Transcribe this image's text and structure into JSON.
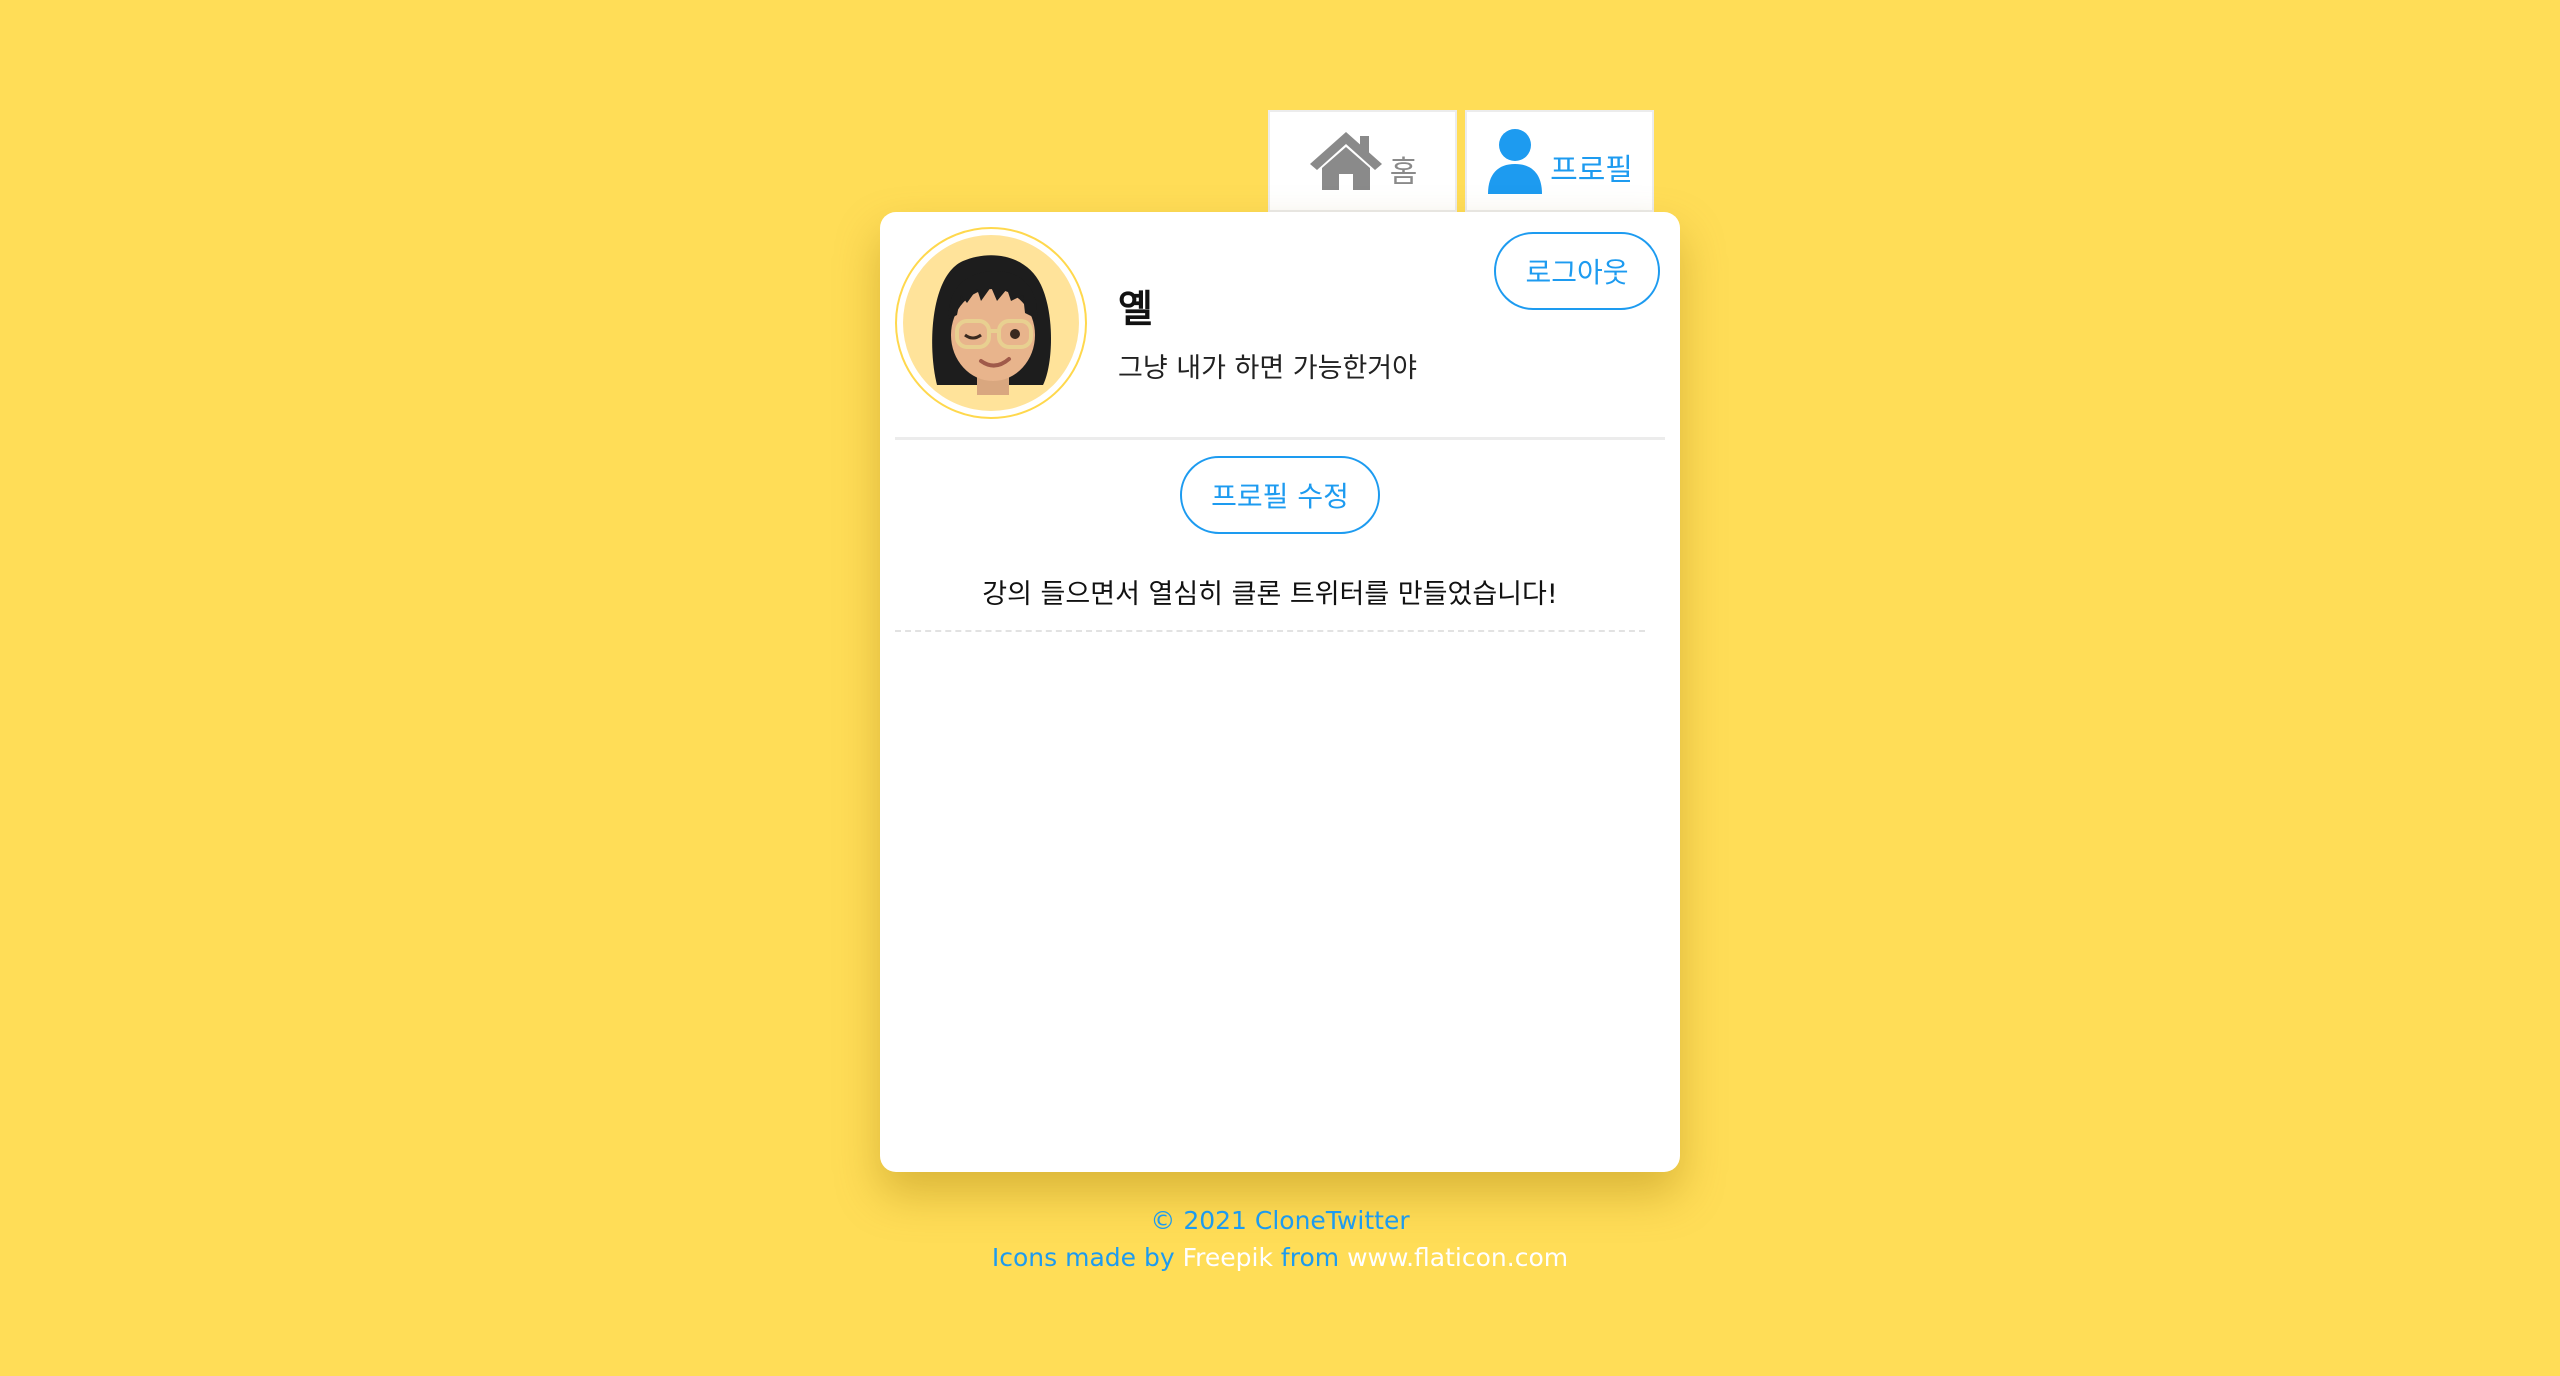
{
  "nav": {
    "home_label": "홈",
    "profile_label": "프로필"
  },
  "profile": {
    "name": "옐",
    "bio": "그냥 내가 하면 가능한거야",
    "logout_label": "로그아웃",
    "edit_label": "프로필 수정"
  },
  "tweets": [
    {
      "text": "강의 들으면서 열심히 클론 트위터를 만들었습니다!"
    }
  ],
  "footer": {
    "copyright": "© 2021 CloneTwitter",
    "icons_prefix": "Icons made by",
    "author": "Freepik",
    "from": "from",
    "site": "www.flaticon.com"
  },
  "colors": {
    "background": "#ffdd57",
    "accent": "#1d9bf0",
    "home_icon": "#8a8a8a",
    "card": "#ffffff"
  },
  "icons": {
    "home": "home-icon",
    "profile": "user-icon",
    "avatar": "memoji-avatar"
  }
}
